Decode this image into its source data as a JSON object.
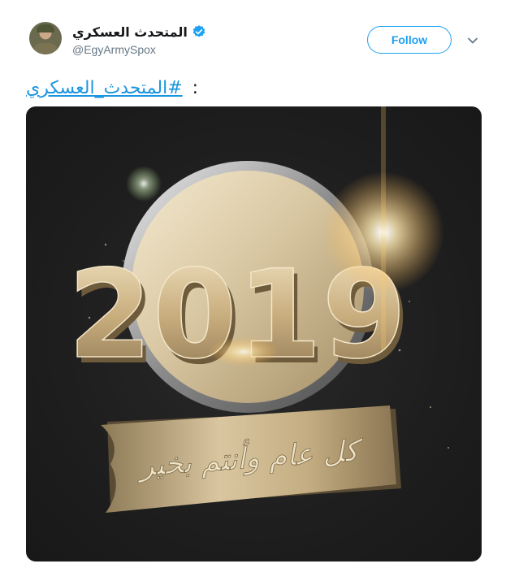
{
  "user": {
    "display_name": "المتحدث العسكري",
    "handle": "@EgyArmySpox",
    "verified": true
  },
  "actions": {
    "follow_label": "Follow"
  },
  "tweet": {
    "hashtag": "#المتحدث_العسكري",
    "trailing": ":"
  },
  "media": {
    "year_text": "2019",
    "banner_text": "كل عام وأنتم بخير"
  },
  "colors": {
    "accent": "#1da1f2",
    "link": "#1b95e0",
    "secondary_text": "#657786",
    "gold": "#c9b58a"
  },
  "icons": {
    "verified": "verified-badge-icon",
    "menu": "chevron-down-icon"
  }
}
